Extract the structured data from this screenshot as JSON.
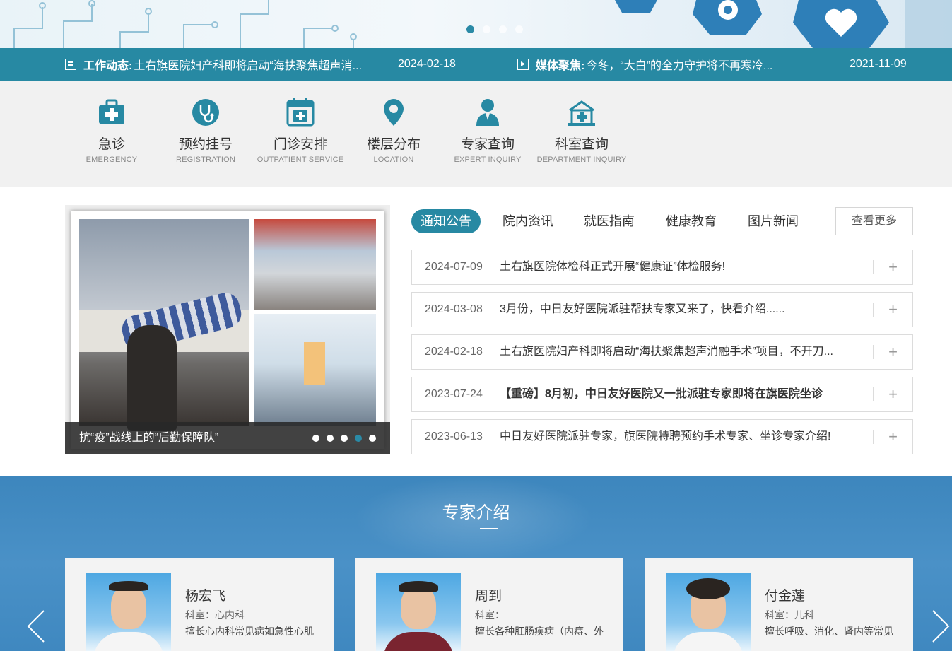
{
  "banner": {
    "slide_count": 4,
    "active_slide": 0
  },
  "ticker": {
    "left": {
      "label": "工作动态:",
      "text": "土右旗医院妇产科即将启动“海扶聚焦超声消...",
      "date": "2024-02-18",
      "icon": "document-icon"
    },
    "right": {
      "label": "媒体聚焦:",
      "text": "今冬，“大白”的全力守护将不再寒冷...",
      "date": "2021-11-09",
      "icon": "play-icon"
    }
  },
  "quick_links": [
    {
      "cn": "急诊",
      "en": "EMERGENCY",
      "icon": "first-aid-icon"
    },
    {
      "cn": "预约挂号",
      "en": "REGISTRATION",
      "icon": "stethoscope-icon"
    },
    {
      "cn": "门诊安排",
      "en": "OUTPATIENT SERVICE",
      "icon": "calendar-icon"
    },
    {
      "cn": "楼层分布",
      "en": "LOCATION",
      "icon": "location-pin-icon"
    },
    {
      "cn": "专家查询",
      "en": "EXPERT INQUIRY",
      "icon": "doctor-icon"
    },
    {
      "cn": "科室查询",
      "en": "DEPARTMENT INQUIRY",
      "icon": "hospital-icon"
    }
  ],
  "photo_slider": {
    "caption": "抗“疫”战线上的“后勤保障队”",
    "slide_count": 5,
    "active_slide": 3
  },
  "news": {
    "tabs": [
      "通知公告",
      "院内资讯",
      "就医指南",
      "健康教育",
      "图片新闻"
    ],
    "active_tab": 0,
    "more_label": "查看更多",
    "items": [
      {
        "date": "2024-07-09",
        "title": "土右旗医院体检科正式开展“健康证”体检服务!",
        "bold": false
      },
      {
        "date": "2024-03-08",
        "title": "3月份，中日友好医院派驻帮扶专家又来了，快看介绍......",
        "bold": false
      },
      {
        "date": "2024-02-18",
        "title": "土右旗医院妇产科即将启动“海扶聚焦超声消融手术”项目，不开刀...",
        "bold": false
      },
      {
        "date": "2023-07-24",
        "title": "【重磅】8月初，中日友好医院又一批派驻专家即将在旗医院坐诊",
        "bold": true
      },
      {
        "date": "2023-06-13",
        "title": "中日友好医院派驻专家，旗医院特聘预约手术专家、坐诊专家介绍!",
        "bold": false
      }
    ]
  },
  "experts": {
    "title": "专家介绍",
    "cards": [
      {
        "name": "杨宏飞",
        "dept": "科室：心内科",
        "desc": "擅长心内科常见病如急性心肌"
      },
      {
        "name": "周到",
        "dept": "科室：",
        "desc": "擅长各种肛肠疾病（内痔、外"
      },
      {
        "name": "付金莲",
        "dept": "科室：儿科",
        "desc": "擅长呼吸、消化、肾内等常见"
      }
    ]
  },
  "colors": {
    "primary": "#2789a3",
    "expert_bg": "#4a91c7"
  }
}
